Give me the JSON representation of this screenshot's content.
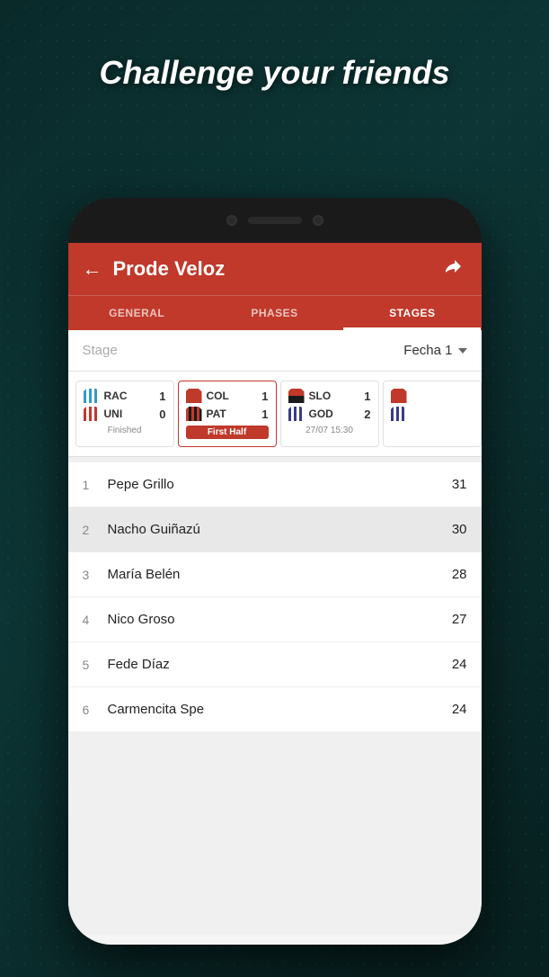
{
  "headline": "Challenge your friends",
  "header": {
    "title": "Prode Veloz",
    "back_label": "←",
    "exit_label": "⤴"
  },
  "tabs": [
    {
      "label": "GENERAL",
      "active": false
    },
    {
      "label": "PHASES",
      "active": false
    },
    {
      "label": "STAGES",
      "active": true
    }
  ],
  "stage_selector": {
    "label": "Stage",
    "value": "Fecha 1"
  },
  "matches": [
    {
      "id": "match1",
      "team1": {
        "name": "RAC",
        "score": 1,
        "jersey": "rac"
      },
      "team2": {
        "name": "UNI",
        "score": 0,
        "jersey": "uni"
      },
      "status": "Finished",
      "status_type": "finished"
    },
    {
      "id": "match2",
      "team1": {
        "name": "COL",
        "score": 1,
        "jersey": "col"
      },
      "team2": {
        "name": "PAT",
        "score": 1,
        "jersey": "pat"
      },
      "status": "First Half",
      "status_type": "live"
    },
    {
      "id": "match3",
      "team1": {
        "name": "SLO",
        "score": 1,
        "jersey": "slo"
      },
      "team2": {
        "name": "GOD",
        "score": 2,
        "jersey": "god"
      },
      "status": "27/07 15:30",
      "status_type": "scheduled"
    },
    {
      "id": "match4",
      "team1": {
        "name": "",
        "score": null,
        "jersey": "4"
      },
      "team2": {
        "name": "",
        "score": null,
        "jersey": "4"
      },
      "status": "",
      "status_type": "scheduled"
    }
  ],
  "leaderboard": [
    {
      "rank": 1,
      "name": "Pepe Grillo",
      "score": 31,
      "highlighted": false
    },
    {
      "rank": 2,
      "name": "Nacho Guiñazú",
      "score": 30,
      "highlighted": true
    },
    {
      "rank": 3,
      "name": "María Belén",
      "score": 28,
      "highlighted": false
    },
    {
      "rank": 4,
      "name": "Nico Groso",
      "score": 27,
      "highlighted": false
    },
    {
      "rank": 5,
      "name": "Fede Díaz",
      "score": 24,
      "highlighted": false
    },
    {
      "rank": 6,
      "name": "Carmencita Spe",
      "score": 24,
      "highlighted": false
    }
  ]
}
